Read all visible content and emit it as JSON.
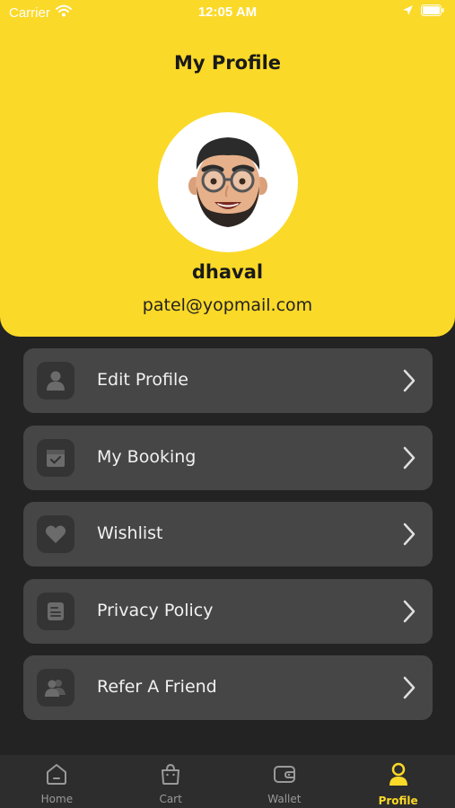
{
  "status_bar": {
    "carrier": "Carrier",
    "time": "12:05 AM"
  },
  "header": {
    "title": "My Profile",
    "accent_color": "#FBD928"
  },
  "profile": {
    "name": "dhaval",
    "email": "patel@yopmail.com"
  },
  "menu": {
    "items": [
      {
        "label": "Edit Profile",
        "icon": "person-icon"
      },
      {
        "label": "My Booking",
        "icon": "booking-box-icon"
      },
      {
        "label": "Wishlist",
        "icon": "heart-icon"
      },
      {
        "label": "Privacy Policy",
        "icon": "document-icon"
      },
      {
        "label": "Refer A Friend",
        "icon": "refer-friend-icon"
      }
    ]
  },
  "tabbar": {
    "tabs": [
      {
        "label": "Home",
        "icon": "home-icon",
        "active": false
      },
      {
        "label": "Cart",
        "icon": "cart-icon",
        "active": false
      },
      {
        "label": "Wallet",
        "icon": "wallet-icon",
        "active": false
      },
      {
        "label": "Profile",
        "icon": "profile-icon",
        "active": true
      }
    ]
  }
}
